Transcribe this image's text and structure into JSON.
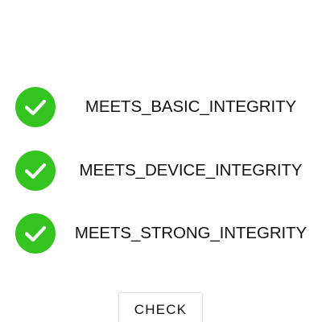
{
  "colors": {
    "check_green": "#34c41f",
    "check_mark": "#ffffff",
    "background": "#ffffff",
    "text": "#111111"
  },
  "results": [
    {
      "label": "MEETS_BASIC_INTEGRITY",
      "status": "pass",
      "icon": "check-circle-icon"
    },
    {
      "label": "MEETS_DEVICE_INTEGRITY",
      "status": "pass",
      "icon": "check-circle-icon"
    },
    {
      "label": "MEETS_STRONG_INTEGRITY",
      "status": "pass",
      "icon": "check-circle-icon"
    }
  ],
  "actions": {
    "check_label": "CHECK"
  }
}
